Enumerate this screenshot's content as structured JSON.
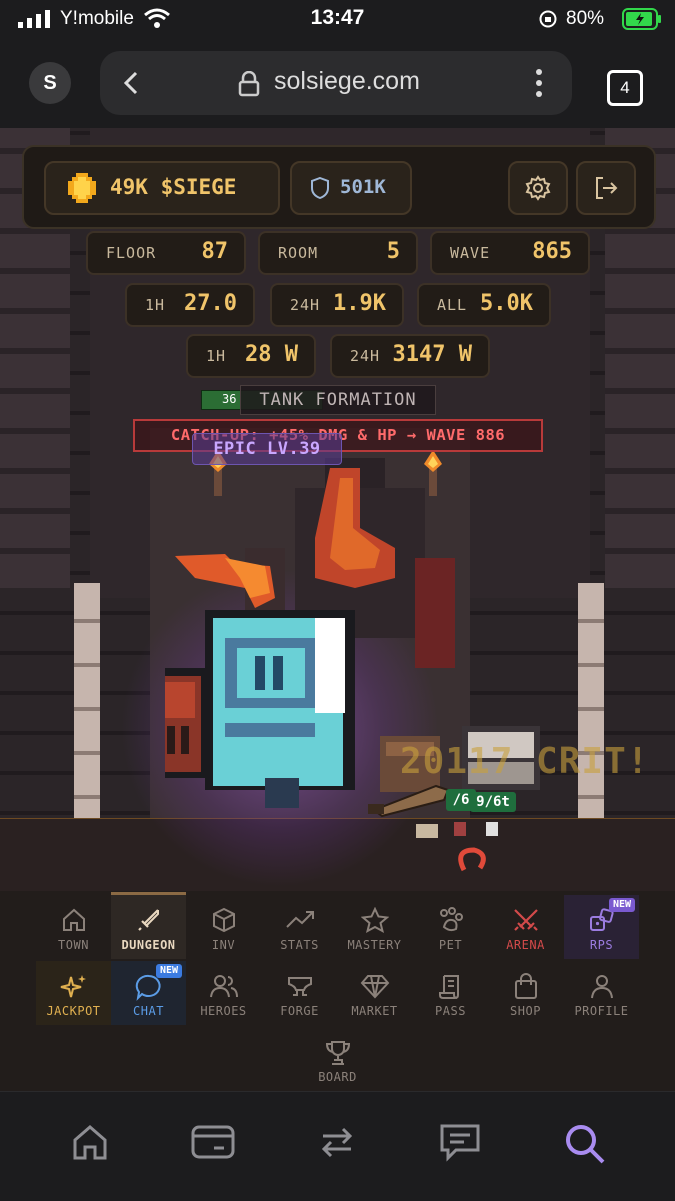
{
  "status_bar": {
    "carrier": "Y!mobile",
    "time": "13:47",
    "battery": "80%"
  },
  "browser": {
    "avatar_letter": "S",
    "url": "solsiege.com",
    "tab_count": "4"
  },
  "hud": {
    "siege_balance": "49K $SIEGE",
    "shield_value": "501K"
  },
  "stats": {
    "floor": {
      "label": "FLOOR",
      "value": "87"
    },
    "room": {
      "label": "ROOM",
      "value": "5"
    },
    "wave": {
      "label": "WAVE",
      "value": "865"
    },
    "h1": {
      "label": "1H",
      "value": "27.0"
    },
    "h24": {
      "label": "24H",
      "value": "1.9K"
    },
    "all": {
      "label": "ALL",
      "value": "5.0K"
    },
    "w1h": {
      "label": "1H",
      "value": "28 W"
    },
    "w24h": {
      "label": "24H",
      "value": "3147 W"
    }
  },
  "battle": {
    "hero_hp": "36",
    "formation": "TANK FORMATION",
    "catchup": "CATCH-UP: +45% DMG & HP → WAVE 886",
    "rarity": "EPIC LV.39",
    "crit_text": "20117 CRIT!",
    "enemy_hp_1": "/6",
    "enemy_hp_2": "9/6t"
  },
  "game_nav": {
    "row1": [
      {
        "label": "TOWN",
        "icon": "house-icon"
      },
      {
        "label": "DUNGEON",
        "icon": "sword-icon"
      },
      {
        "label": "INV",
        "icon": "box-icon"
      },
      {
        "label": "STATS",
        "icon": "trend-icon"
      },
      {
        "label": "MASTERY",
        "icon": "star-icon"
      },
      {
        "label": "PET",
        "icon": "paw-icon"
      },
      {
        "label": "ARENA",
        "icon": "crossed-swords-icon"
      },
      {
        "label": "RPS",
        "icon": "dice-icon",
        "badge": "NEW"
      }
    ],
    "row2": [
      {
        "label": "JACKPOT",
        "icon": "sparkle-icon"
      },
      {
        "label": "CHAT",
        "icon": "chat-icon",
        "badge": "NEW"
      },
      {
        "label": "HEROES",
        "icon": "users-icon"
      },
      {
        "label": "FORGE",
        "icon": "anvil-icon"
      },
      {
        "label": "MARKET",
        "icon": "gem-icon"
      },
      {
        "label": "PASS",
        "icon": "scroll-icon"
      },
      {
        "label": "SHOP",
        "icon": "bag-icon"
      },
      {
        "label": "PROFILE",
        "icon": "user-icon"
      }
    ],
    "row3": [
      {
        "label": "BOARD",
        "icon": "trophy-icon"
      }
    ]
  },
  "colors": {
    "gold": "#f0c46a",
    "arena_red": "#d34a4a",
    "rps_purple": "#9b7ce0",
    "chat_blue": "#5b9ce6",
    "hp_green": "#2b6d34"
  }
}
